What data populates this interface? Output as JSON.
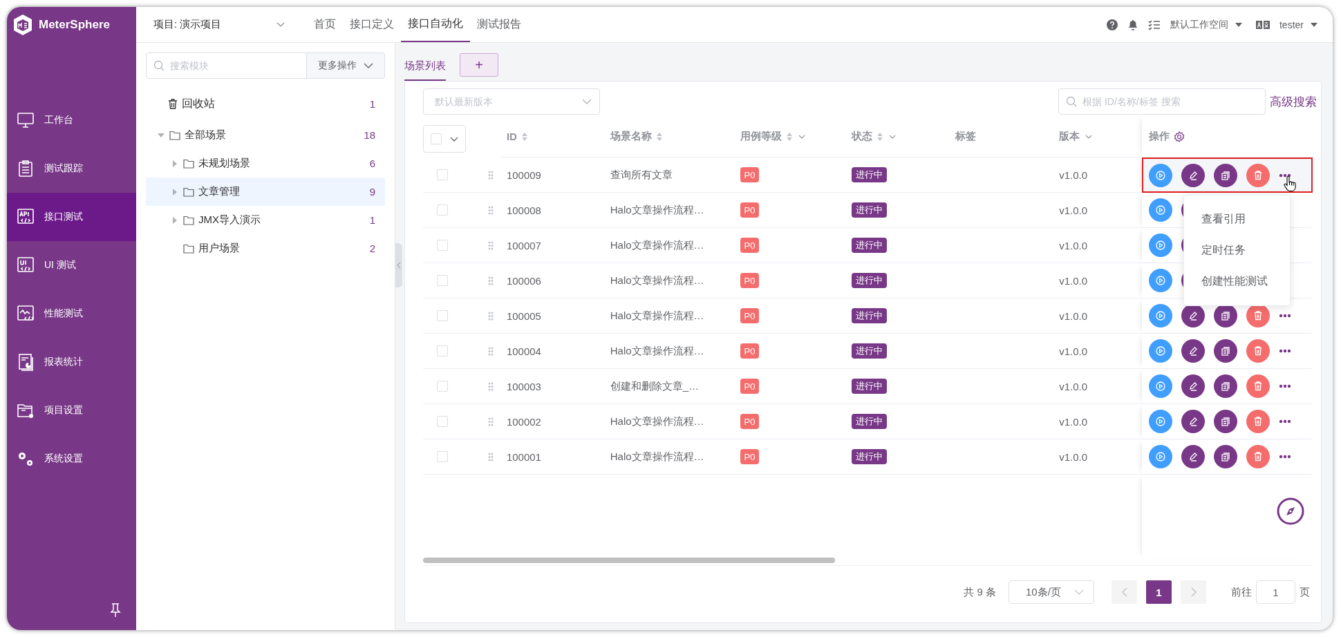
{
  "app": {
    "name": "MeterSphere"
  },
  "sidebar": {
    "items": [
      {
        "label": "工作台",
        "kind": "monitor",
        "selected": false
      },
      {
        "label": "测试跟踪",
        "kind": "clipboard",
        "selected": false
      },
      {
        "label": "接口测试",
        "kind": "api",
        "selected": true
      },
      {
        "label": "UI 测试",
        "kind": "ui",
        "selected": false
      },
      {
        "label": "性能测试",
        "kind": "chart",
        "selected": false
      },
      {
        "label": "报表统计",
        "kind": "report",
        "selected": false
      },
      {
        "label": "项目设置",
        "kind": "folder",
        "selected": false
      },
      {
        "label": "系统设置",
        "kind": "gears",
        "selected": false
      }
    ]
  },
  "header": {
    "project": "项目: 演示项目",
    "nav": [
      {
        "label": "首页",
        "selected": false
      },
      {
        "label": "接口定义",
        "selected": false
      },
      {
        "label": "接口自动化",
        "selected": true
      },
      {
        "label": "测试报告",
        "selected": false
      }
    ],
    "workspace": "默认工作空间",
    "user": "tester"
  },
  "module_tree": {
    "search_placeholder": "搜索模块",
    "more_button": "更多操作",
    "recycle": {
      "label": "回收站",
      "count": "1"
    },
    "nodes": [
      {
        "label": "全部场景",
        "count": "18",
        "expandable": true,
        "expanded": true,
        "selected": false,
        "children": [
          {
            "label": "未规划场景",
            "count": "6",
            "expandable": true,
            "expanded": false,
            "selected": false
          },
          {
            "label": "文章管理",
            "count": "9",
            "expandable": true,
            "expanded": false,
            "selected": true
          },
          {
            "label": "JMX导入演示",
            "count": "1",
            "expandable": true,
            "expanded": false,
            "selected": false
          },
          {
            "label": "用户场景",
            "count": "2",
            "expandable": false,
            "selected": false
          }
        ]
      }
    ]
  },
  "tabs": [
    {
      "label": "场景列表",
      "selected": true
    }
  ],
  "add_tab": "+",
  "toolbar": {
    "version_placeholder": "默认最新版本",
    "search_placeholder": "根据 ID/名称/标签 搜索",
    "advanced_search": "高级搜索"
  },
  "table": {
    "columns": [
      {
        "label": "ID",
        "sortable": true,
        "filterable": false
      },
      {
        "label": "场景名称",
        "sortable": true,
        "filterable": false
      },
      {
        "label": "用例等级",
        "sortable": true,
        "filterable": true
      },
      {
        "label": "状态",
        "sortable": true,
        "filterable": true
      },
      {
        "label": "标签",
        "sortable": false,
        "filterable": false
      },
      {
        "label": "版本",
        "sortable": false,
        "filterable": true
      }
    ],
    "actions_column": "操作",
    "select_all_checked": false,
    "rows": [
      {
        "id": "100009",
        "name": "查询所有文章",
        "level": "P0",
        "status": "进行中",
        "version": "v1.0.0",
        "checked": false,
        "highlighted": true,
        "menu_open": true
      },
      {
        "id": "100008",
        "name": "Halo文章操作流程…",
        "level": "P0",
        "status": "进行中",
        "version": "v1.0.0",
        "checked": false,
        "highlighted": false,
        "menu_open": false
      },
      {
        "id": "100007",
        "name": "Halo文章操作流程…",
        "level": "P0",
        "status": "进行中",
        "version": "v1.0.0",
        "checked": false,
        "highlighted": false,
        "menu_open": false
      },
      {
        "id": "100006",
        "name": "Halo文章操作流程…",
        "level": "P0",
        "status": "进行中",
        "version": "v1.0.0",
        "checked": false,
        "highlighted": false,
        "menu_open": false
      },
      {
        "id": "100005",
        "name": "Halo文章操作流程…",
        "level": "P0",
        "status": "进行中",
        "version": "v1.0.0",
        "checked": false,
        "highlighted": false,
        "menu_open": false
      },
      {
        "id": "100004",
        "name": "Halo文章操作流程…",
        "level": "P0",
        "status": "进行中",
        "version": "v1.0.0",
        "checked": false,
        "highlighted": false,
        "menu_open": false
      },
      {
        "id": "100003",
        "name": "创建和删除文章_…",
        "level": "P0",
        "status": "进行中",
        "version": "v1.0.0",
        "checked": false,
        "highlighted": false,
        "menu_open": false
      },
      {
        "id": "100002",
        "name": "Halo文章操作流程…",
        "level": "P0",
        "status": "进行中",
        "version": "v1.0.0",
        "checked": false,
        "highlighted": false,
        "menu_open": false
      },
      {
        "id": "100001",
        "name": "Halo文章操作流程…",
        "level": "P0",
        "status": "进行中",
        "version": "v1.0.0",
        "checked": false,
        "highlighted": false,
        "menu_open": false
      }
    ]
  },
  "row_menu": {
    "items": [
      "查看引用",
      "定时任务",
      "创建性能测试"
    ]
  },
  "pagination": {
    "total": "共 9 条",
    "page_size": "10条/页",
    "pages": [
      {
        "label": "1",
        "selected": true
      }
    ],
    "goto_label": "前往",
    "goto_value": "1",
    "page_suffix": "页"
  }
}
